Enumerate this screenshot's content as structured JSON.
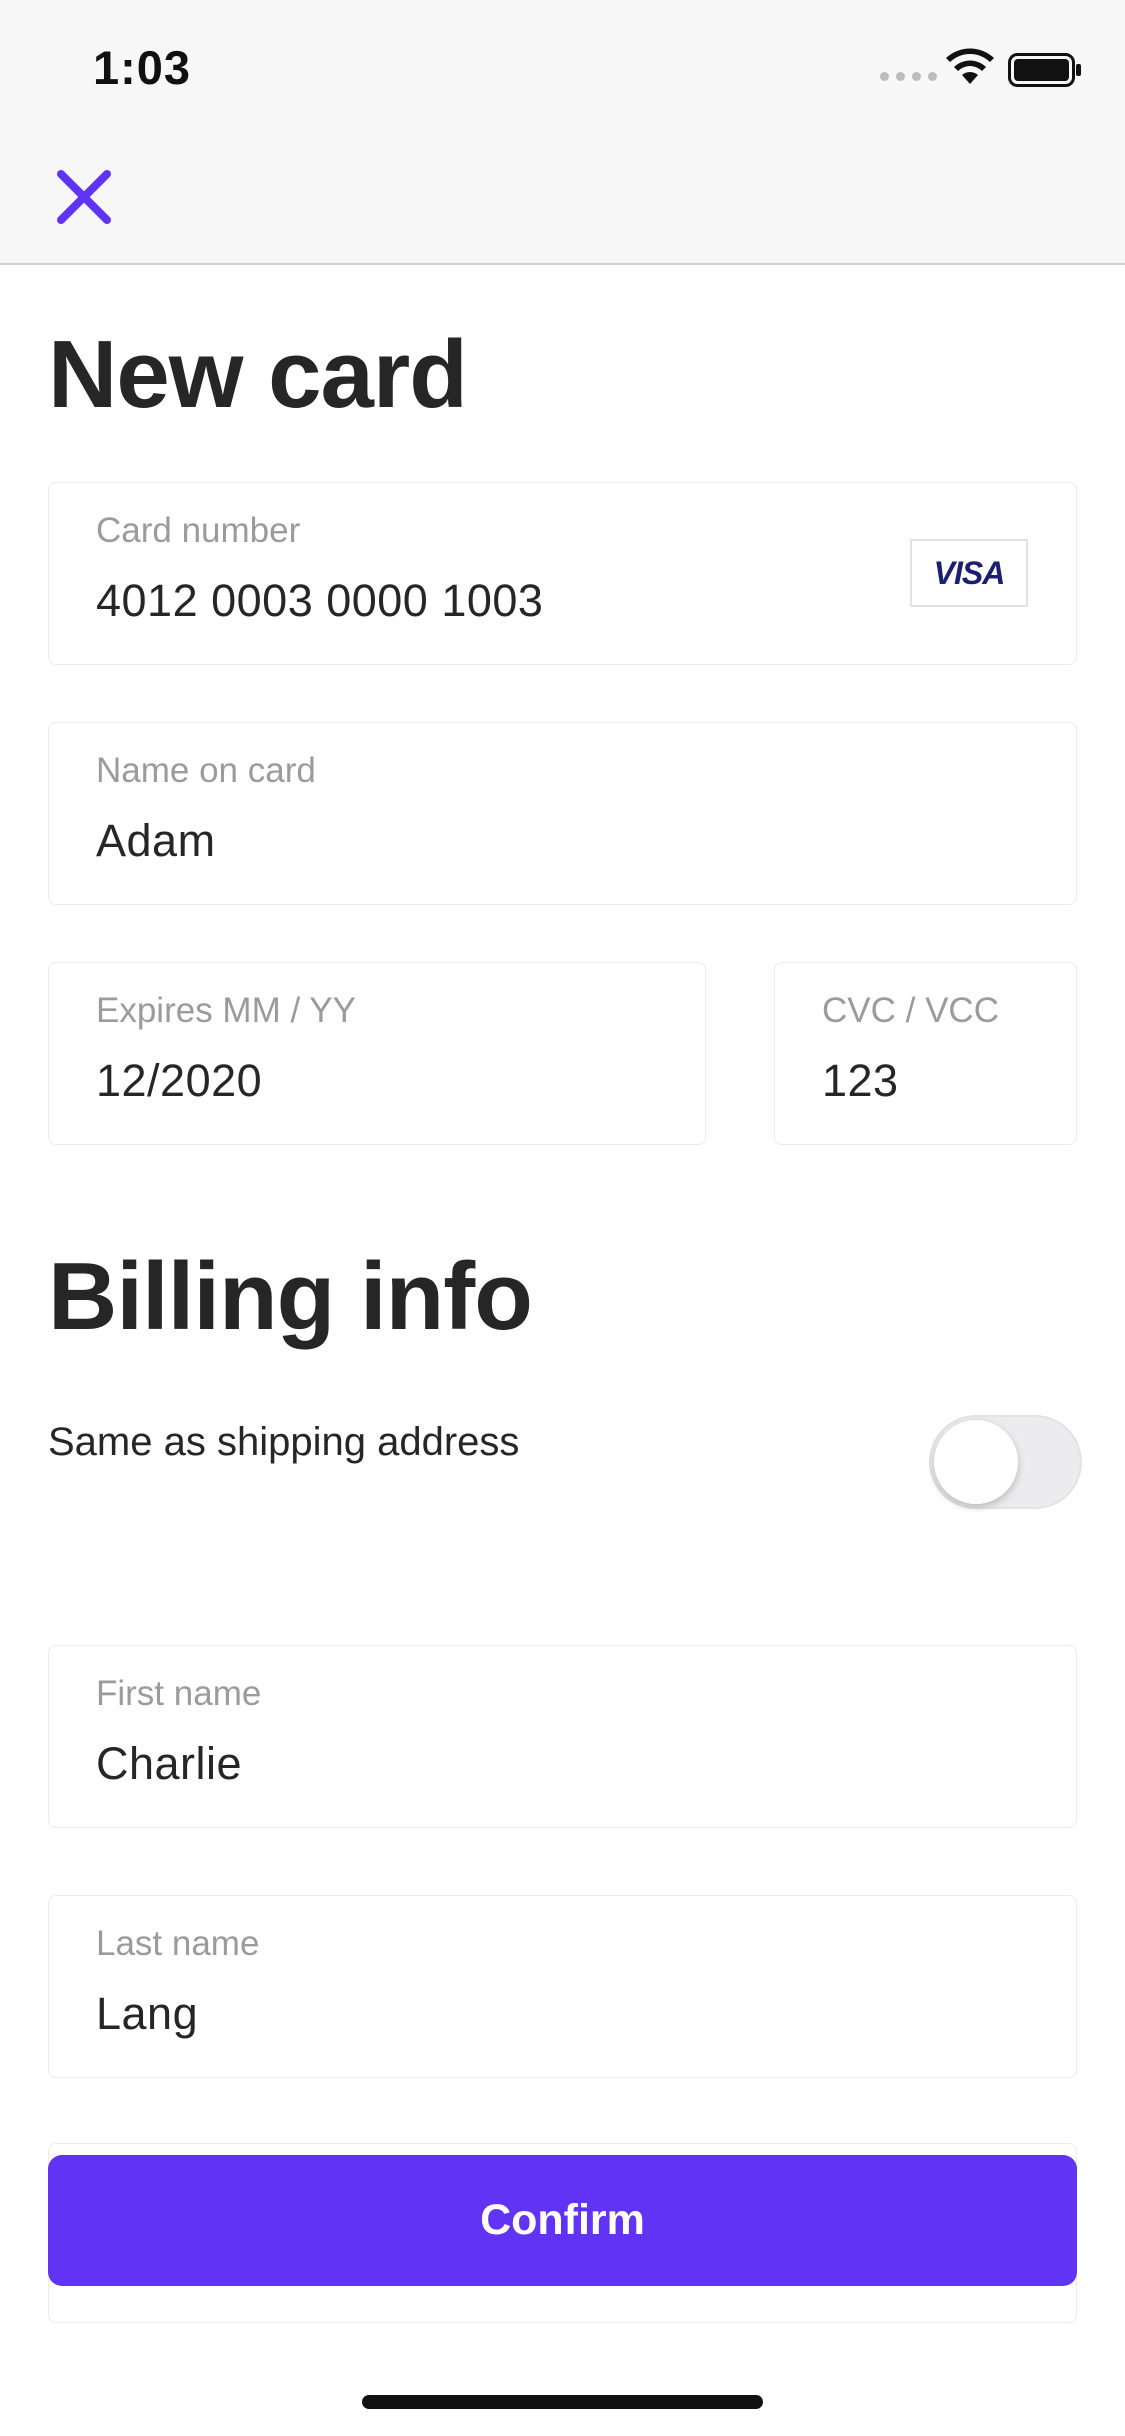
{
  "status_bar": {
    "time": "1:03"
  },
  "nav": {
    "close_icon": "close-icon"
  },
  "card_section": {
    "title": "New card",
    "card_number": {
      "label": "Card number",
      "value": "4012 0003 0000 1003",
      "brand": "VISA"
    },
    "name_on_card": {
      "label": "Name on card",
      "value": "Adam"
    },
    "expires": {
      "label": "Expires MM / YY",
      "value": "12/2020"
    },
    "cvc": {
      "label": "CVC / VCC",
      "value": "123"
    }
  },
  "billing_section": {
    "title": "Billing info",
    "same_as_shipping": {
      "label": "Same as shipping address",
      "enabled": false
    },
    "first_name": {
      "label": "First name",
      "value": "Charlie"
    },
    "last_name": {
      "label": "Last name",
      "value": "Lang"
    }
  },
  "actions": {
    "confirm_label": "Confirm"
  },
  "colors": {
    "accent": "#6134f5",
    "text": "#262626",
    "label": "#9b9b9b",
    "field_border": "#ececef"
  }
}
